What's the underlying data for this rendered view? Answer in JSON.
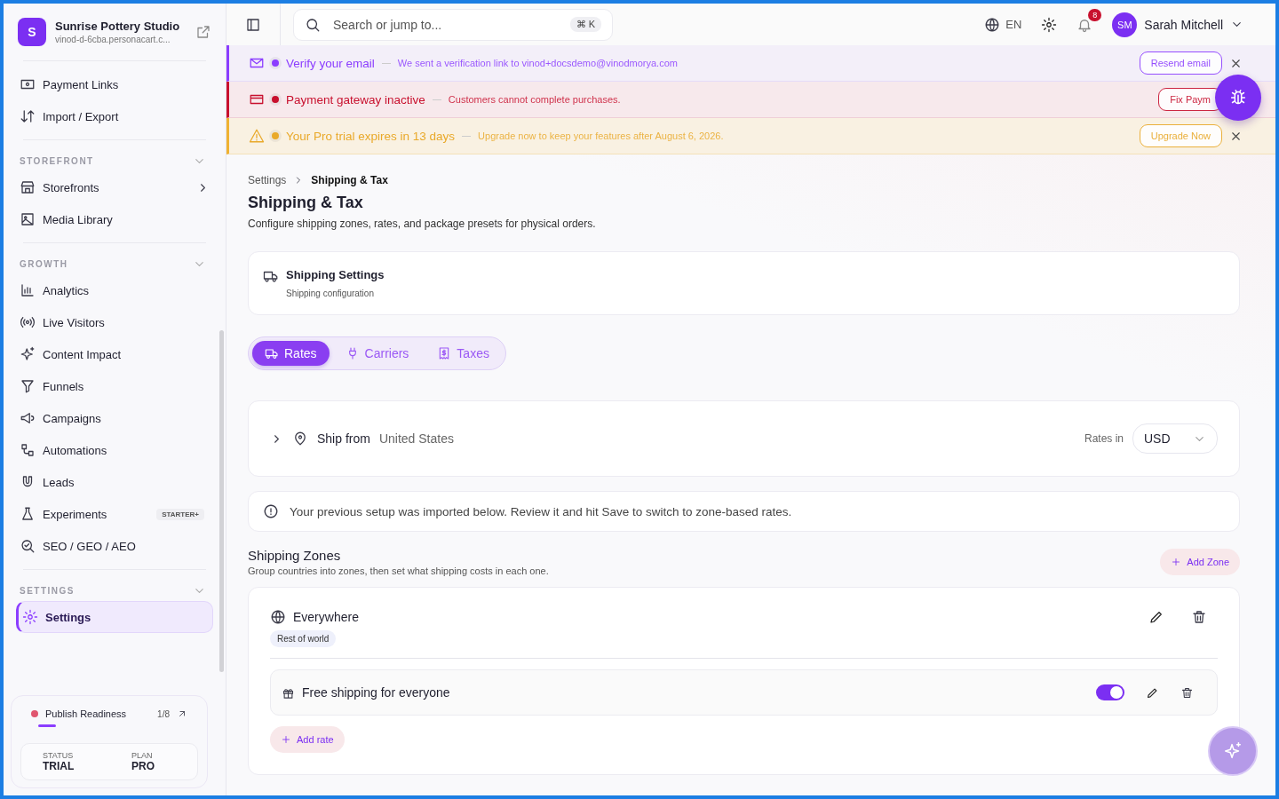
{
  "sidebar": {
    "brand": {
      "initial": "S",
      "name": "Sunrise Pottery Studio",
      "url": "vinod-d-6cba.personacart.c..."
    },
    "items": [
      {
        "label": "Payment Links",
        "selected": false
      },
      {
        "label": "Import / Export",
        "selected": false
      }
    ],
    "sections": [
      {
        "title": "STOREFRONT",
        "expanded": true,
        "items": [
          {
            "label": "Storefronts",
            "selected": false,
            "submenu": true
          },
          {
            "label": "Media Library",
            "selected": false,
            "submenu": false
          }
        ]
      },
      {
        "title": "GROWTH",
        "expanded": true,
        "items": [
          {
            "label": "Analytics",
            "selected": false,
            "submenu": false
          },
          {
            "label": "Live Visitors",
            "selected": false,
            "submenu": false
          },
          {
            "label": "Content Impact",
            "selected": false,
            "submenu": false
          },
          {
            "label": "Funnels",
            "selected": false,
            "submenu": false
          },
          {
            "label": "Campaigns",
            "selected": false,
            "submenu": false
          },
          {
            "label": "Automations",
            "selected": false,
            "submenu": false
          },
          {
            "label": "Leads",
            "selected": false,
            "submenu": false
          },
          {
            "label": "Experiments",
            "selected": false,
            "submenu": false,
            "badge": "STARTER+"
          },
          {
            "label": "SEO / GEO / AEO",
            "selected": false,
            "submenu": false
          }
        ]
      },
      {
        "title": "SETTINGS",
        "expanded": true,
        "items": [
          {
            "label": "Settings",
            "selected": true,
            "submenu": false
          }
        ]
      }
    ],
    "readiness": {
      "label": "Publish Readiness",
      "count": "1/8",
      "level": 0.125,
      "color": "#e0566f"
    },
    "status": [
      {
        "label": "STATUS",
        "value": "TRIAL"
      },
      {
        "label": "PLAN",
        "value": "PRO"
      }
    ]
  },
  "topbar": {
    "search": {
      "placeholder": "Search or jump to...",
      "shortcut": "⌘ K"
    },
    "language": "EN",
    "notifications": "8",
    "user": {
      "initials": "SM",
      "name": "Sarah Mitchell"
    }
  },
  "banners": [
    {
      "kind": "info",
      "title": "Verify your email",
      "message": "We sent a verification link to vinod+docsdemo@vinodmorya.com",
      "action": "Resend email"
    },
    {
      "kind": "error",
      "title": "Payment gateway inactive",
      "message": "Customers cannot complete purchases.",
      "action": "Fix Paym"
    },
    {
      "kind": "warning",
      "title": "Your Pro trial expires in 13 days",
      "message": "Upgrade now to keep your features after August 6, 2026.",
      "action": "Upgrade Now"
    }
  ],
  "breadcrumb": [
    "Settings",
    "Shipping & Tax"
  ],
  "page": {
    "title": "Shipping & Tax",
    "subtitle": "Configure shipping zones, rates, and package presets for physical orders."
  },
  "settings_card": {
    "title": "Shipping Settings",
    "subtitle": "Shipping configuration"
  },
  "tabs": [
    {
      "label": "Rates",
      "selected": true
    },
    {
      "label": "Carriers",
      "selected": false
    },
    {
      "label": "Taxes",
      "selected": false
    }
  ],
  "ship_from": {
    "expanded": false,
    "label": "Ship from",
    "value": "United States",
    "rates_label": "Rates in",
    "currency": "USD"
  },
  "notice": "Your previous setup was imported below. Review it and hit Save to switch to zone-based rates.",
  "zones_section": {
    "title": "Shipping Zones",
    "subtitle": "Group countries into zones, then set what shipping costs in each one.",
    "add_button": "Add Zone"
  },
  "zones": [
    {
      "name": "Everywhere",
      "tag": "Rest of world",
      "rates": [
        {
          "name": "Free shipping for everyone",
          "on": true
        }
      ],
      "add_rate": "Add rate"
    }
  ]
}
